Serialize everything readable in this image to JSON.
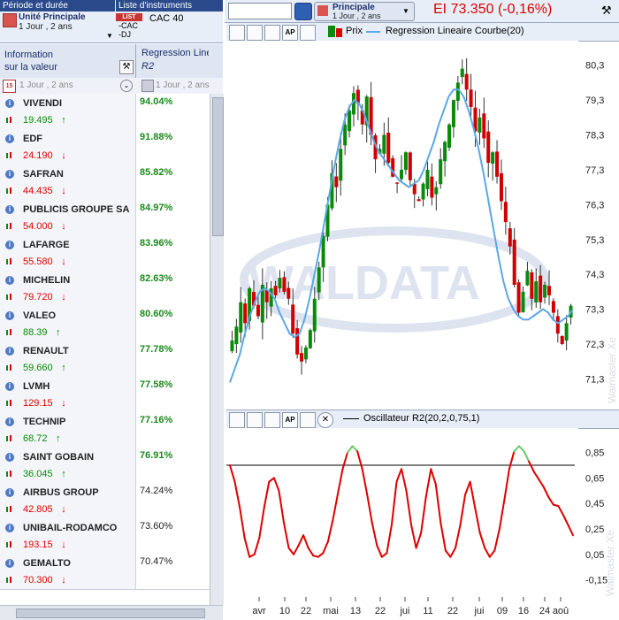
{
  "left_panel": {
    "period_title": "Période et durée",
    "unit_label": "Unité Principale",
    "unit_value": "1 Jour , 2 ans",
    "instruments_title": "Liste d'instruments",
    "list_badge": "LIST",
    "list_name": "CAC 40",
    "list_items": [
      "-CAC",
      "-DJ"
    ],
    "col_info_line1": "Information",
    "col_info_line2": "sur la valeur",
    "col_reg_line1": "Regression Line",
    "col_reg_line2": "R2",
    "sub_info": "1 Jour , 2 ans",
    "sub_reg": "1 Jour , 2 ans",
    "calendar_day": "15",
    "rows": [
      {
        "name": "VIVENDI",
        "price": "19.495",
        "dir": "up",
        "value": "94.04%",
        "strong": true
      },
      {
        "name": "EDF",
        "price": "24.190",
        "dir": "down",
        "value": "91.88%",
        "strong": true
      },
      {
        "name": "SAFRAN",
        "price": "44.435",
        "dir": "down",
        "value": "85.82%",
        "strong": true
      },
      {
        "name": "PUBLICIS GROUPE SA",
        "price": "54.000",
        "dir": "down",
        "value": "84.97%",
        "strong": true
      },
      {
        "name": "LAFARGE",
        "price": "55.580",
        "dir": "down",
        "value": "83.96%",
        "strong": true
      },
      {
        "name": "MICHELIN",
        "price": "79.720",
        "dir": "down",
        "value": "82.63%",
        "strong": true
      },
      {
        "name": "VALEO",
        "price": "88.39",
        "dir": "up",
        "value": "80.60%",
        "strong": true
      },
      {
        "name": "RENAULT",
        "price": "59.660",
        "dir": "up",
        "value": "77.78%",
        "strong": true
      },
      {
        "name": "LVMH",
        "price": "129.15",
        "dir": "down",
        "value": "77.58%",
        "strong": true
      },
      {
        "name": "TECHNIP",
        "price": "68.72",
        "dir": "up",
        "value": "77.16%",
        "strong": true
      },
      {
        "name": "SAINT GOBAIN",
        "price": "36.045",
        "dir": "up",
        "value": "76.91%",
        "strong": true
      },
      {
        "name": "AIRBUS GROUP",
        "price": "42.805",
        "dir": "down",
        "value": "74.24%",
        "strong": false
      },
      {
        "name": "UNIBAIL-RODAMCO",
        "price": "193.15",
        "dir": "down",
        "value": "73.60%",
        "strong": false
      },
      {
        "name": "GEMALTO",
        "price": "70.300",
        "dir": "down",
        "value": "70.47%",
        "strong": false
      }
    ]
  },
  "right_panel": {
    "unit_label": "Principale",
    "unit_value": "1 Jour , 2 ans",
    "quote": "EI 73.350 (-0,16%)",
    "legend_price": "Prix",
    "legend_reg": "Regression Lineaire Courbe(20)",
    "legend_osc": "Oscillateur R2(20,2,0,75,1)",
    "watermark": "Waimaster Xe",
    "logo_text": "WALDATA",
    "colors": {
      "up": "#0a8a0a",
      "down": "#d00000",
      "regline": "#5aa8e8",
      "osc_hi": "#66cc66",
      "osc_lo": "#dd0000"
    }
  },
  "chart_data": [
    {
      "type": "candlestick",
      "y_ticks": [
        "80,3",
        "79,3",
        "78,3",
        "77,3",
        "76,3",
        "75,3",
        "74,3",
        "73,3",
        "72,3",
        "71,3"
      ],
      "x_ticks": [
        "avr",
        "10",
        "22",
        "mai",
        "13",
        "22",
        "jui",
        "11",
        "22",
        "jui",
        "09",
        "16",
        "24",
        "aoû"
      ],
      "ylim": [
        70.6,
        80.8
      ],
      "closes": [
        72.4,
        72.8,
        73.5,
        72.9,
        73.9,
        73.4,
        73.1,
        74.0,
        73.5,
        73.9,
        73.7,
        74.2,
        73.8,
        73.6,
        72.6,
        72.0,
        71.8,
        72.2,
        72.7,
        73.6,
        74.5,
        75.4,
        76.3,
        77.2,
        76.8,
        77.9,
        78.6,
        79.0,
        79.5,
        79.2,
        78.6,
        79.4,
        78.3,
        77.6,
        77.9,
        78.3,
        77.5,
        77.1,
        76.9,
        77.3,
        77.8,
        77.0,
        76.6,
        76.4,
        76.9,
        77.3,
        76.5,
        76.8,
        77.6,
        78.1,
        78.6,
        79.3,
        79.8,
        80.2,
        79.6,
        79.1,
        78.4,
        78.8,
        78.2,
        77.5,
        77.8,
        77.1,
        76.4,
        75.8,
        75.1,
        74.0,
        73.2,
        73.8,
        74.4,
        73.6,
        74.1,
        73.5,
        74.0,
        73.7,
        73.2,
        72.6,
        72.3,
        72.9,
        73.4
      ],
      "regline": [
        71.2,
        71.6,
        72.0,
        72.6,
        73.1,
        73.5,
        73.8,
        73.9,
        73.8,
        73.6,
        73.2,
        72.9,
        72.6,
        72.5,
        72.6,
        73.0,
        73.6,
        74.3,
        75.0,
        75.8,
        76.6,
        77.4,
        78.1,
        78.7,
        79.1,
        79.3,
        79.2,
        78.9,
        78.5,
        78.1,
        77.8,
        77.6,
        77.4,
        77.2,
        77.0,
        76.9,
        76.8,
        76.9,
        77.0,
        77.3,
        77.7,
        78.1,
        78.6,
        79.0,
        79.4,
        79.6,
        79.6,
        79.4,
        79.0,
        78.5,
        77.9,
        77.2,
        76.4,
        75.6,
        74.8,
        74.1,
        73.6,
        73.3,
        73.1,
        73.0,
        73.0,
        73.1,
        73.2,
        73.3,
        73.2,
        73.0,
        72.9,
        73.0,
        73.1,
        73.3
      ]
    },
    {
      "type": "line",
      "y_ticks": [
        "0,85",
        "0,65",
        "0,45",
        "0,25",
        "0,05",
        "-0,15"
      ],
      "ylim": [
        -0.25,
        1.0
      ],
      "threshold": 0.75,
      "values": [
        0.75,
        0.62,
        0.42,
        0.18,
        0.03,
        0.05,
        0.18,
        0.42,
        0.62,
        0.65,
        0.55,
        0.3,
        0.1,
        0.05,
        0.12,
        0.2,
        0.1,
        0.04,
        0.03,
        0.06,
        0.15,
        0.32,
        0.52,
        0.72,
        0.85,
        0.9,
        0.86,
        0.72,
        0.52,
        0.3,
        0.12,
        0.03,
        0.06,
        0.28,
        0.62,
        0.72,
        0.55,
        0.28,
        0.1,
        0.22,
        0.5,
        0.72,
        0.6,
        0.3,
        0.08,
        0.03,
        0.1,
        0.28,
        0.52,
        0.62,
        0.42,
        0.22,
        0.1,
        0.03,
        0.08,
        0.25,
        0.48,
        0.72,
        0.86,
        0.9,
        0.86,
        0.78,
        0.7,
        0.64,
        0.58,
        0.5,
        0.44,
        0.43,
        0.36,
        0.28,
        0.2
      ]
    }
  ]
}
